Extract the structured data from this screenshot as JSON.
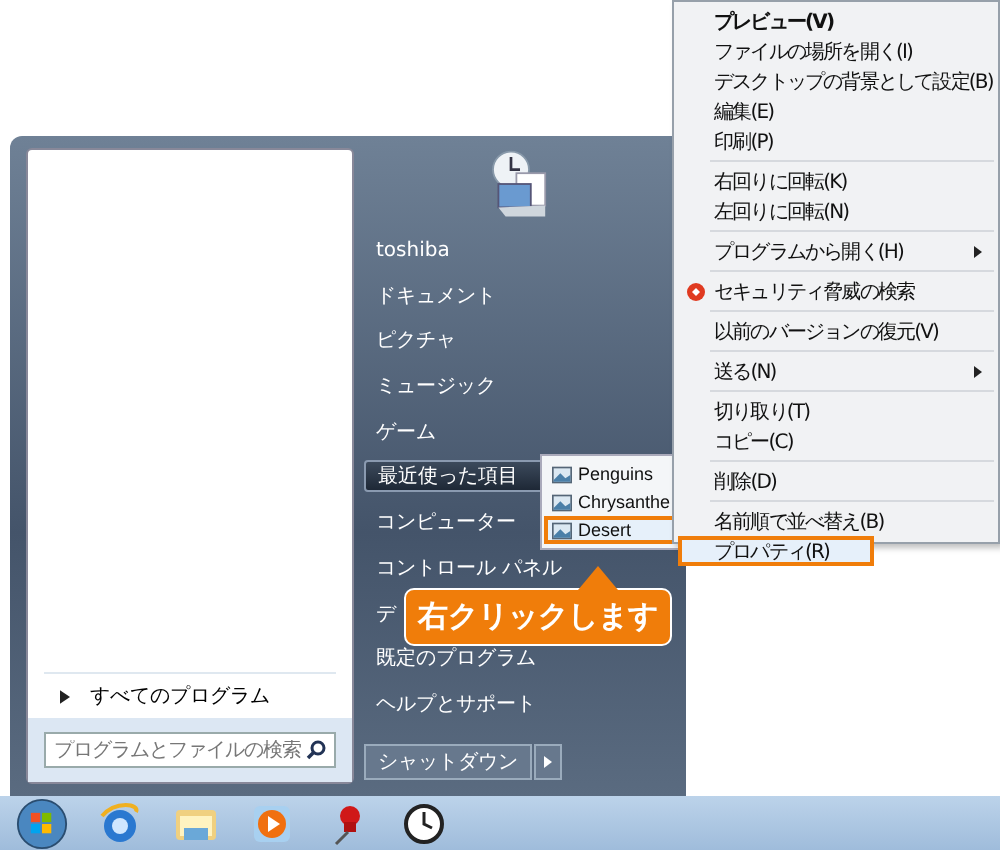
{
  "start_menu": {
    "all_programs": "すべてのプログラム",
    "search": {
      "placeholder": "プログラムとファイルの検索"
    },
    "right_items": [
      {
        "label": "toshiba",
        "selected": false,
        "has_submenu": false
      },
      {
        "label": "ドキュメント",
        "selected": false,
        "has_submenu": false
      },
      {
        "label": "ピクチャ",
        "selected": false,
        "has_submenu": false
      },
      {
        "label": "ミュージック",
        "selected": false,
        "has_submenu": false
      },
      {
        "label": "ゲーム",
        "selected": false,
        "has_submenu": false
      },
      {
        "label": "最近使った項目",
        "selected": true,
        "has_submenu": true
      },
      {
        "label": "コンピューター",
        "selected": false,
        "has_submenu": false
      },
      {
        "label": "コントロール パネル",
        "selected": false,
        "has_submenu": false
      },
      {
        "label": "デ",
        "selected": false,
        "has_submenu": false
      },
      {
        "label": "既定のプログラム",
        "selected": false,
        "has_submenu": false
      },
      {
        "label": "ヘルプとサポート",
        "selected": false,
        "has_submenu": false
      }
    ],
    "shutdown": "シャットダウン"
  },
  "recent_submenu": [
    {
      "label": "Penguins",
      "selected": false
    },
    {
      "label": "Chrysanthe",
      "selected": false
    },
    {
      "label": "Desert",
      "selected": true
    }
  ],
  "context_menu": {
    "groups": [
      [
        {
          "label": "プレビュー(V)",
          "bold": true,
          "has_submenu": false,
          "shield": false,
          "selected": false
        },
        {
          "label": "ファイルの場所を開く(I)",
          "bold": false,
          "has_submenu": false,
          "shield": false,
          "selected": false
        },
        {
          "label": "デスクトップの背景として設定(B)",
          "bold": false,
          "has_submenu": false,
          "shield": false,
          "selected": false
        },
        {
          "label": "編集(E)",
          "bold": false,
          "has_submenu": false,
          "shield": false,
          "selected": false
        },
        {
          "label": "印刷(P)",
          "bold": false,
          "has_submenu": false,
          "shield": false,
          "selected": false
        }
      ],
      [
        {
          "label": "右回りに回転(K)",
          "bold": false,
          "has_submenu": false,
          "shield": false,
          "selected": false
        },
        {
          "label": "左回りに回転(N)",
          "bold": false,
          "has_submenu": false,
          "shield": false,
          "selected": false
        }
      ],
      [
        {
          "label": "プログラムから開く(H)",
          "bold": false,
          "has_submenu": true,
          "shield": false,
          "selected": false
        }
      ],
      [
        {
          "label": "セキュリティ脅威の検索",
          "bold": false,
          "has_submenu": false,
          "shield": true,
          "selected": false
        }
      ],
      [
        {
          "label": "以前のバージョンの復元(V)",
          "bold": false,
          "has_submenu": false,
          "shield": false,
          "selected": false
        }
      ],
      [
        {
          "label": "送る(N)",
          "bold": false,
          "has_submenu": true,
          "shield": false,
          "selected": false
        }
      ],
      [
        {
          "label": "切り取り(T)",
          "bold": false,
          "has_submenu": false,
          "shield": false,
          "selected": false
        },
        {
          "label": "コピー(C)",
          "bold": false,
          "has_submenu": false,
          "shield": false,
          "selected": false
        }
      ],
      [
        {
          "label": "削除(D)",
          "bold": false,
          "has_submenu": false,
          "shield": false,
          "selected": false
        }
      ],
      [
        {
          "label": "名前順で並べ替え(B)",
          "bold": false,
          "has_submenu": false,
          "shield": false,
          "selected": false
        },
        {
          "label": "プロパティ(R)",
          "bold": false,
          "has_submenu": false,
          "shield": false,
          "selected": true
        }
      ]
    ]
  },
  "callout": {
    "text": "右クリックします"
  }
}
